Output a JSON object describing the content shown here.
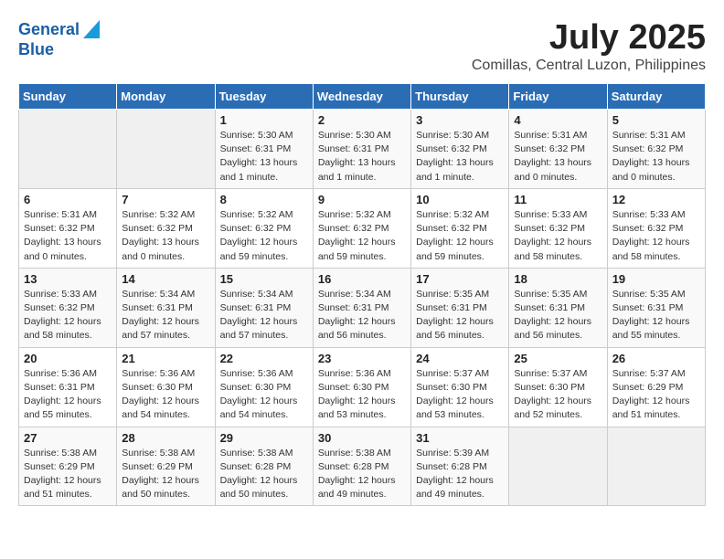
{
  "logo": {
    "line1": "General",
    "line2": "Blue"
  },
  "title": "July 2025",
  "subtitle": "Comillas, Central Luzon, Philippines",
  "days_header": [
    "Sunday",
    "Monday",
    "Tuesday",
    "Wednesday",
    "Thursday",
    "Friday",
    "Saturday"
  ],
  "weeks": [
    [
      {
        "day": "",
        "info": ""
      },
      {
        "day": "",
        "info": ""
      },
      {
        "day": "1",
        "info": "Sunrise: 5:30 AM\nSunset: 6:31 PM\nDaylight: 13 hours and 1 minute."
      },
      {
        "day": "2",
        "info": "Sunrise: 5:30 AM\nSunset: 6:31 PM\nDaylight: 13 hours and 1 minute."
      },
      {
        "day": "3",
        "info": "Sunrise: 5:30 AM\nSunset: 6:32 PM\nDaylight: 13 hours and 1 minute."
      },
      {
        "day": "4",
        "info": "Sunrise: 5:31 AM\nSunset: 6:32 PM\nDaylight: 13 hours and 0 minutes."
      },
      {
        "day": "5",
        "info": "Sunrise: 5:31 AM\nSunset: 6:32 PM\nDaylight: 13 hours and 0 minutes."
      }
    ],
    [
      {
        "day": "6",
        "info": "Sunrise: 5:31 AM\nSunset: 6:32 PM\nDaylight: 13 hours and 0 minutes."
      },
      {
        "day": "7",
        "info": "Sunrise: 5:32 AM\nSunset: 6:32 PM\nDaylight: 13 hours and 0 minutes."
      },
      {
        "day": "8",
        "info": "Sunrise: 5:32 AM\nSunset: 6:32 PM\nDaylight: 12 hours and 59 minutes."
      },
      {
        "day": "9",
        "info": "Sunrise: 5:32 AM\nSunset: 6:32 PM\nDaylight: 12 hours and 59 minutes."
      },
      {
        "day": "10",
        "info": "Sunrise: 5:32 AM\nSunset: 6:32 PM\nDaylight: 12 hours and 59 minutes."
      },
      {
        "day": "11",
        "info": "Sunrise: 5:33 AM\nSunset: 6:32 PM\nDaylight: 12 hours and 58 minutes."
      },
      {
        "day": "12",
        "info": "Sunrise: 5:33 AM\nSunset: 6:32 PM\nDaylight: 12 hours and 58 minutes."
      }
    ],
    [
      {
        "day": "13",
        "info": "Sunrise: 5:33 AM\nSunset: 6:32 PM\nDaylight: 12 hours and 58 minutes."
      },
      {
        "day": "14",
        "info": "Sunrise: 5:34 AM\nSunset: 6:31 PM\nDaylight: 12 hours and 57 minutes."
      },
      {
        "day": "15",
        "info": "Sunrise: 5:34 AM\nSunset: 6:31 PM\nDaylight: 12 hours and 57 minutes."
      },
      {
        "day": "16",
        "info": "Sunrise: 5:34 AM\nSunset: 6:31 PM\nDaylight: 12 hours and 56 minutes."
      },
      {
        "day": "17",
        "info": "Sunrise: 5:35 AM\nSunset: 6:31 PM\nDaylight: 12 hours and 56 minutes."
      },
      {
        "day": "18",
        "info": "Sunrise: 5:35 AM\nSunset: 6:31 PM\nDaylight: 12 hours and 56 minutes."
      },
      {
        "day": "19",
        "info": "Sunrise: 5:35 AM\nSunset: 6:31 PM\nDaylight: 12 hours and 55 minutes."
      }
    ],
    [
      {
        "day": "20",
        "info": "Sunrise: 5:36 AM\nSunset: 6:31 PM\nDaylight: 12 hours and 55 minutes."
      },
      {
        "day": "21",
        "info": "Sunrise: 5:36 AM\nSunset: 6:30 PM\nDaylight: 12 hours and 54 minutes."
      },
      {
        "day": "22",
        "info": "Sunrise: 5:36 AM\nSunset: 6:30 PM\nDaylight: 12 hours and 54 minutes."
      },
      {
        "day": "23",
        "info": "Sunrise: 5:36 AM\nSunset: 6:30 PM\nDaylight: 12 hours and 53 minutes."
      },
      {
        "day": "24",
        "info": "Sunrise: 5:37 AM\nSunset: 6:30 PM\nDaylight: 12 hours and 53 minutes."
      },
      {
        "day": "25",
        "info": "Sunrise: 5:37 AM\nSunset: 6:30 PM\nDaylight: 12 hours and 52 minutes."
      },
      {
        "day": "26",
        "info": "Sunrise: 5:37 AM\nSunset: 6:29 PM\nDaylight: 12 hours and 51 minutes."
      }
    ],
    [
      {
        "day": "27",
        "info": "Sunrise: 5:38 AM\nSunset: 6:29 PM\nDaylight: 12 hours and 51 minutes."
      },
      {
        "day": "28",
        "info": "Sunrise: 5:38 AM\nSunset: 6:29 PM\nDaylight: 12 hours and 50 minutes."
      },
      {
        "day": "29",
        "info": "Sunrise: 5:38 AM\nSunset: 6:28 PM\nDaylight: 12 hours and 50 minutes."
      },
      {
        "day": "30",
        "info": "Sunrise: 5:38 AM\nSunset: 6:28 PM\nDaylight: 12 hours and 49 minutes."
      },
      {
        "day": "31",
        "info": "Sunrise: 5:39 AM\nSunset: 6:28 PM\nDaylight: 12 hours and 49 minutes."
      },
      {
        "day": "",
        "info": ""
      },
      {
        "day": "",
        "info": ""
      }
    ]
  ]
}
